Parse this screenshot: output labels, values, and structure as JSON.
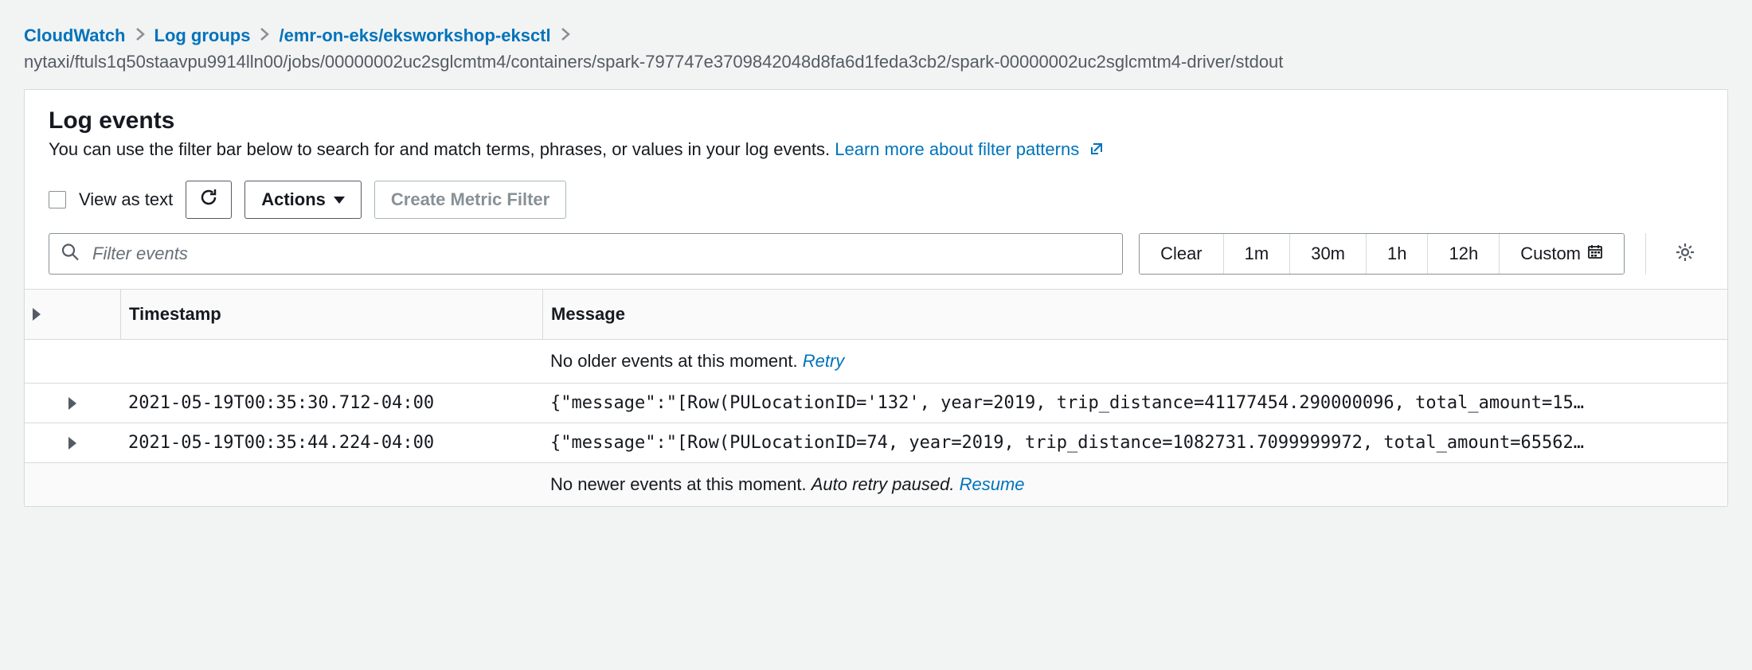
{
  "breadcrumb": {
    "items": [
      {
        "label": "CloudWatch"
      },
      {
        "label": "Log groups"
      },
      {
        "label": "/emr-on-eks/eksworkshop-eksctl"
      }
    ],
    "current": "nytaxi/ftuls1q50staavpu9914lln00/jobs/00000002uc2sglcmtm4/containers/spark-797747e3709842048d8fa6d1feda3cb2/spark-00000002uc2sglcmtm4-driver/stdout"
  },
  "panel": {
    "title": "Log events",
    "subtitle_pre": "You can use the filter bar below to search for and match terms, phrases, or values in your log events. ",
    "learn_more": "Learn more about filter patterns"
  },
  "toolbar": {
    "view_as_text": "View as text",
    "actions": "Actions",
    "create_metric_filter": "Create Metric Filter"
  },
  "search": {
    "placeholder": "Filter events"
  },
  "time_ranges": {
    "clear": "Clear",
    "m1": "1m",
    "m30": "30m",
    "h1": "1h",
    "h12": "12h",
    "custom": "Custom"
  },
  "table": {
    "headers": {
      "timestamp": "Timestamp",
      "message": "Message"
    },
    "older_status": "No older events at this moment. ",
    "older_retry": "Retry",
    "rows": [
      {
        "timestamp": "2021-05-19T00:35:30.712-04:00",
        "message": "{\"message\":\"[Row(PULocationID='132', year=2019, trip_distance=41177454.290000096, total_amount=15…"
      },
      {
        "timestamp": "2021-05-19T00:35:44.224-04:00",
        "message": "{\"message\":\"[Row(PULocationID=74, year=2019, trip_distance=1082731.7099999972, total_amount=65562…"
      }
    ],
    "newer_status_pre": "No newer events at this moment. ",
    "newer_status_italic": "Auto retry paused. ",
    "newer_resume": "Resume"
  }
}
